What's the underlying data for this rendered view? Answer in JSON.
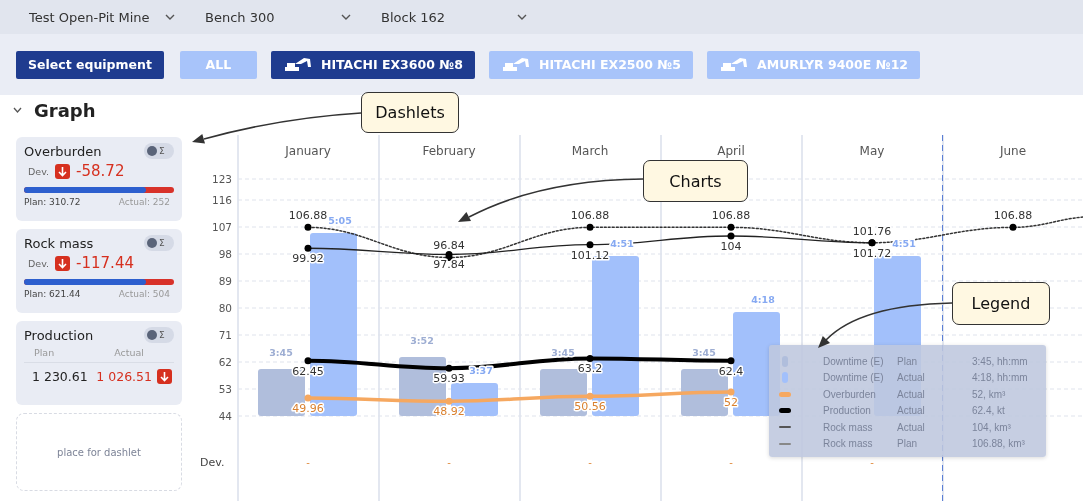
{
  "filters": [
    {
      "label": "Test Open-Pit Mine"
    },
    {
      "label": "Bench 300"
    },
    {
      "label": "Block 162"
    }
  ],
  "select_equipment": "Select equipment",
  "equipment": [
    {
      "label": "ALL",
      "kind": "text",
      "selected": false
    },
    {
      "label": "HITACHI EX3600 №8",
      "kind": "excavator",
      "selected": true
    },
    {
      "label": "HITACHI EX2500 №5",
      "kind": "excavator",
      "selected": false
    },
    {
      "label": "AMURLYR 9400E №12",
      "kind": "excavator",
      "selected": false
    }
  ],
  "section": {
    "title": "Graph",
    "expanded": true
  },
  "dashlets": [
    {
      "kind": "progress",
      "title": "Overburden",
      "toggle": {
        "on": false,
        "symbol": "Σ"
      },
      "dev_label": "Dev.",
      "negative": true,
      "deviation": "-58.72",
      "level": 0.81,
      "plan": "Plan: 310.72",
      "actual": "Actual: 252"
    },
    {
      "kind": "progress",
      "title": "Rock mass",
      "toggle": {
        "on": false,
        "symbol": "Σ"
      },
      "dev_label": "Dev.",
      "negative": true,
      "deviation": "-117.44",
      "level": 0.81,
      "plan": "Plan: 621.44",
      "actual": "Actual: 504"
    },
    {
      "kind": "table",
      "title": "Production",
      "toggle": {
        "on": false,
        "symbol": "Σ"
      },
      "plan_label": "Plan",
      "actual_label": "Actual",
      "plan": "1 230.61",
      "actual": "1 026.51",
      "negative": true
    },
    {
      "kind": "placeholder",
      "text": "place for dashlet"
    }
  ],
  "chart": {
    "chart_data": {
      "type": "bar",
      "categories": [
        "January",
        "February",
        "March",
        "April",
        "May",
        "June"
      ],
      "yticks": [
        44,
        53,
        62,
        71,
        80,
        89,
        98,
        107,
        116,
        123
      ],
      "ylim": [
        44,
        123
      ],
      "grid": true,
      "series": [
        {
          "color": "#b0bedc",
          "values": [
            59.7,
            63.7,
            59.7,
            59.7,
            null,
            null
          ]
        },
        {
          "color": "#a2c0fb",
          "values": [
            105,
            55,
            97.3,
            78.7,
            97.3,
            null
          ]
        },
        {
          "type": "line",
          "line_style": "dotted",
          "marker": "circle",
          "data_labels": true,
          "color": "#333333",
          "values": [
            106.88,
            96.84,
            106.88,
            106.88,
            101.76,
            106.88
          ]
        },
        {
          "type": "line",
          "line_style": "solid",
          "marker": "circle",
          "data_labels": true,
          "color": "#222222",
          "values": [
            99.92,
            97.84,
            101.12,
            104,
            101.72,
            null
          ]
        },
        {
          "type": "line",
          "line_style": "solid",
          "marker": "circle",
          "data_labels": true,
          "color": "#000000",
          "values": [
            62.45,
            59.93,
            63.2,
            62.4,
            null,
            null
          ]
        },
        {
          "type": "line",
          "line_style": "solid",
          "marker": "circle",
          "data_labels": true,
          "color": "#f6a860",
          "values": [
            49.96,
            48.92,
            50.56,
            52,
            null,
            null
          ]
        }
      ],
      "annotations": [
        {
          "text": "3:45",
          "x": "January",
          "y": 59.7
        },
        {
          "text": "5:05",
          "x": "January",
          "y": 105
        },
        {
          "text": "3:52",
          "x": "February",
          "y": 63.7
        },
        {
          "text": "3:37",
          "x": "February",
          "y": 55
        },
        {
          "text": "3:45",
          "x": "March",
          "y": 59.7
        },
        {
          "text": "4:51",
          "x": "March",
          "y": 97.3
        },
        {
          "text": "3:45",
          "x": "April",
          "y": 59.7
        },
        {
          "text": "4:18",
          "x": "April",
          "y": 78.7
        },
        {
          "text": "4:51",
          "x": "May",
          "y": 97.3
        }
      ]
    },
    "dev_label": "Dev.",
    "deviations": [
      "-",
      "-",
      "-",
      "-",
      "-"
    ]
  },
  "legend": {
    "rows": [
      {
        "kind": "bar",
        "color": "#b0bedc",
        "name": "Downtime (E)",
        "type": "Plan",
        "value": "3:45, hh:mm"
      },
      {
        "kind": "bar",
        "color": "#a2c0fb",
        "name": "Downtime (E)",
        "type": "Actual",
        "value": "4:18, hh:mm"
      },
      {
        "kind": "thick-line",
        "color": "#f6a860",
        "name": "Overburden",
        "type": "Actual",
        "value": "52, km³"
      },
      {
        "kind": "thick-line",
        "color": "#000000",
        "name": "Production",
        "type": "Actual",
        "value": "62.4, kt"
      },
      {
        "kind": "line",
        "color": "#555555",
        "name": "Rock mass",
        "type": "Actual",
        "value": "104, km³"
      },
      {
        "kind": "line",
        "color": "#888888",
        "name": "Rock mass",
        "type": "Plan",
        "value": "106.88, km³"
      }
    ]
  },
  "callouts": [
    {
      "text": "Dashlets"
    },
    {
      "text": "Charts"
    },
    {
      "text": "Legend"
    }
  ]
}
